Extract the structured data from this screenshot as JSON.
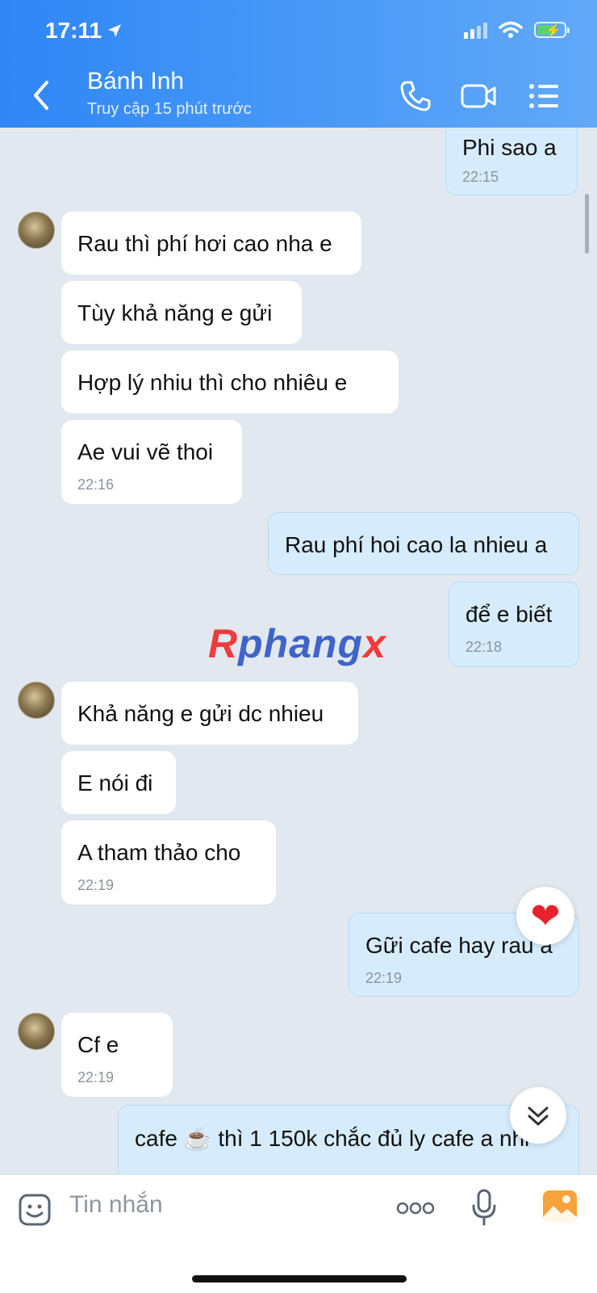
{
  "status_bar": {
    "time": "17:11"
  },
  "header": {
    "contact_name": "Bánh Inh",
    "contact_status": "Truy cập 15 phút trước"
  },
  "messages": [
    {
      "dir": "out",
      "text": "Phi sao a",
      "time": "22:15"
    },
    {
      "dir": "in",
      "text": "Rau thì phí hơi cao nha e"
    },
    {
      "dir": "in",
      "text": "Tùy khả năng e gửi"
    },
    {
      "dir": "in",
      "text": "Hợp lý nhiu thì cho nhiêu e"
    },
    {
      "dir": "in",
      "text": "Ae vui vẽ thoi",
      "time": "22:16"
    },
    {
      "dir": "out",
      "text": "Rau phí hoi cao la nhieu a"
    },
    {
      "dir": "out",
      "text": "để e biết",
      "time": "22:18"
    },
    {
      "dir": "in",
      "text": "Khả năng e gửi dc nhieu"
    },
    {
      "dir": "in",
      "text": "E nói đi"
    },
    {
      "dir": "in",
      "text": "A tham thảo cho",
      "time": "22:19"
    },
    {
      "dir": "out",
      "text": "Gữi cafe hay rau a",
      "time": "22:19",
      "reaction": "❤"
    },
    {
      "dir": "in",
      "text": "Cf e",
      "time": "22:19"
    },
    {
      "dir": "out",
      "text": "cafe ☕ thì 1 150k chắc đủ ly cafe a nhỉ"
    }
  ],
  "watermark": {
    "r": "R",
    "mid": "phang",
    "x": "x"
  },
  "composer": {
    "placeholder": "Tin nhắn"
  }
}
